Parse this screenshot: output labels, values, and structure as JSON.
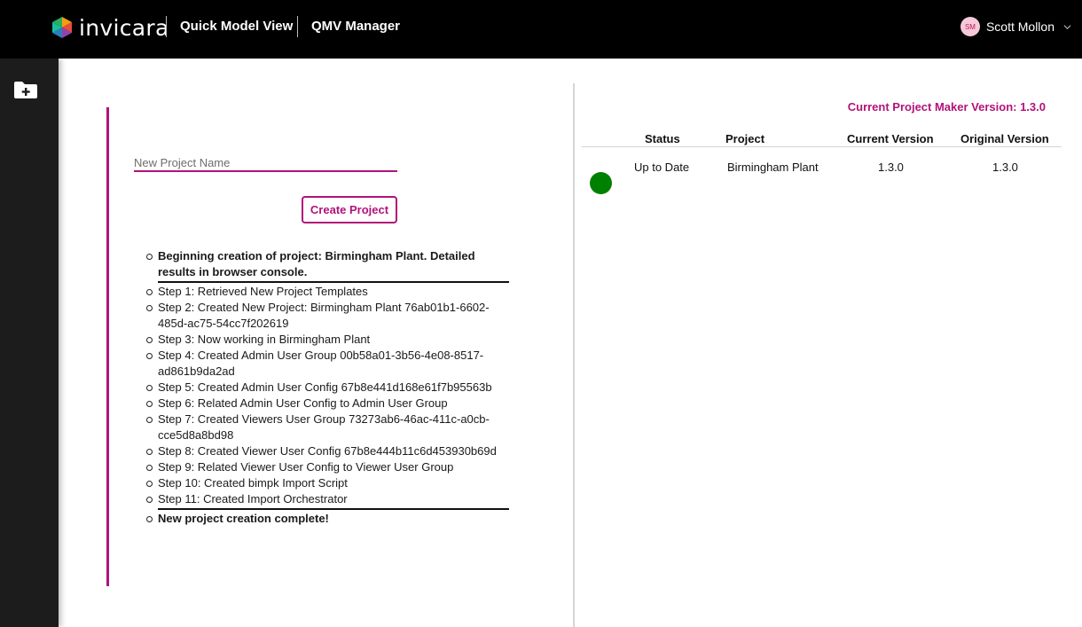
{
  "header": {
    "logo_text": "invicara",
    "app_name": "Quick Model View",
    "page_name": "QMV Manager",
    "user": {
      "initials": "SM",
      "name": "Scott Mollon"
    }
  },
  "sidebar": {
    "items": [
      {
        "icon": "folder-plus-icon"
      }
    ]
  },
  "form": {
    "name_placeholder": "New Project Name",
    "name_value": "",
    "create_label": "Create Project"
  },
  "log": {
    "header": "Beginning creation of project: Birmingham Plant. Detailed results in browser console.",
    "steps": [
      "Step 1: Retrieved New Project Templates",
      "Step 2: Created New Project: Birmingham Plant 76ab01b1-6602-485d-ac75-54cc7f202619",
      "Step 3: Now working in Birmingham Plant",
      "Step 4: Created Admin User Group 00b58a01-3b56-4e08-8517-ad861b9da2ad",
      "Step 5: Created Admin User Config 67b8e441d168e61f7b95563b",
      "Step 6: Related Admin User Config to Admin User Group",
      "Step 7: Created Viewers User Group 73273ab6-46ac-411c-a0cb-cce5d8a8bd98",
      "Step 8: Created Viewer User Config 67b8e444b11c6d453930b69d",
      "Step 9: Related Viewer User Config to Viewer User Group",
      "Step 10: Created bimpk Import Script",
      "Step 11: Created Import Orchestrator"
    ],
    "footer": "New project creation complete!"
  },
  "version_info": {
    "label": "Current Project Maker Version: 1.3.0"
  },
  "projects_table": {
    "columns": [
      "Status",
      "Project",
      "Current Version",
      "Original Version"
    ],
    "rows": [
      {
        "status_color": "#008000",
        "status": "Up to Date",
        "project": "Birmingham Plant",
        "current_version": "1.3.0",
        "original_version": "1.3.0"
      }
    ]
  },
  "colors": {
    "accent": "#b2127a",
    "header_bg": "#000000",
    "sidebar_bg": "#1c1c1c",
    "status_ok": "#008000"
  }
}
